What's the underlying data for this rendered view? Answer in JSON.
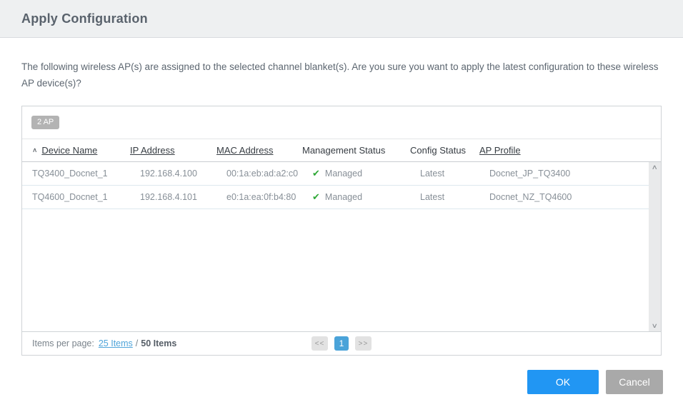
{
  "header": {
    "title": "Apply Configuration"
  },
  "message": "The following wireless AP(s) are assigned to the selected channel blanket(s). Are you sure you want to apply the latest configuration to these wireless AP device(s)?",
  "table": {
    "count_badge": "2 AP",
    "columns": [
      {
        "label": "Device Name",
        "sortable": true,
        "sorted": "asc"
      },
      {
        "label": "IP Address",
        "sortable": true
      },
      {
        "label": "MAC Address",
        "sortable": true
      },
      {
        "label": "Management Status",
        "sortable": false
      },
      {
        "label": "Config Status",
        "sortable": false
      },
      {
        "label": "AP Profile",
        "sortable": true
      }
    ],
    "rows": [
      {
        "device_name": "TQ3400_Docnet_1",
        "ip_address": "192.168.4.100",
        "mac_address": "00:1a:eb:ad:a2:c0",
        "management_status": "Managed",
        "config_status": "Latest",
        "ap_profile": "Docnet_JP_TQ3400"
      },
      {
        "device_name": "TQ4600_Docnet_1",
        "ip_address": "192.168.4.101",
        "mac_address": "e0:1a:ea:0f:b4:80",
        "management_status": "Managed",
        "config_status": "Latest",
        "ap_profile": "Docnet_NZ_TQ4600"
      }
    ]
  },
  "icons": {
    "sort_asc": "∧",
    "check": "✔",
    "scroll_up": "∧",
    "scroll_down": "∨"
  },
  "pagination": {
    "items_per_page_label": "Items per page:",
    "page_size_link": "25 Items",
    "separator": "/",
    "total_items": "50 Items",
    "prev_label": "<<",
    "current_page": "1",
    "next_label": ">>"
  },
  "footer": {
    "ok_label": "OK",
    "cancel_label": "Cancel"
  },
  "colors": {
    "titlebar_bg": "#eef0f1",
    "ok_button": "#2196f3",
    "cancel_button": "#a9a9a9",
    "active_page": "#4aa3d9",
    "link": "#4fa4d9",
    "check_green": "#2ea836",
    "badge": "#b3b3b3"
  }
}
